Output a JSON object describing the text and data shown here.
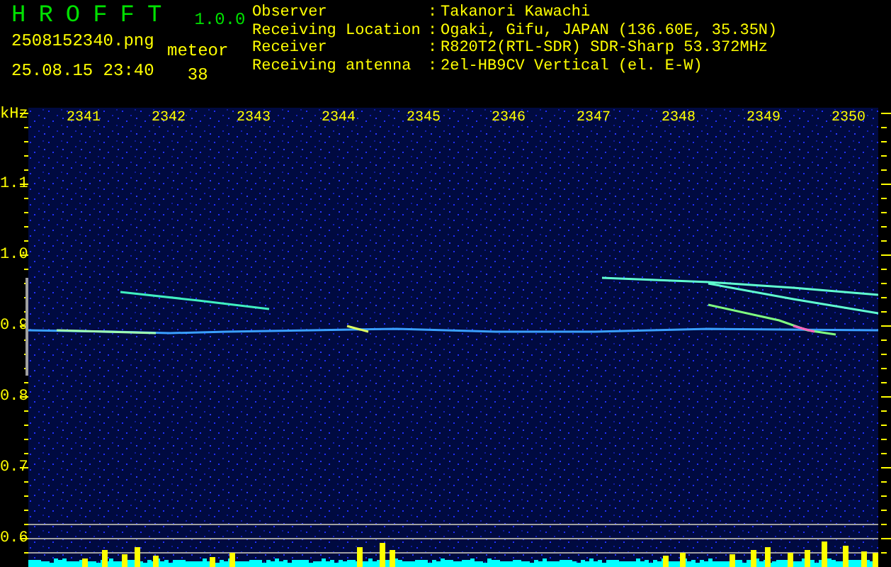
{
  "header": {
    "logo": "HROFFT",
    "version": "1.0.0",
    "filename": "2508152340.png",
    "datetime": "25.08.15 23:40",
    "count_label": "meteor",
    "count": "38"
  },
  "info": [
    {
      "label": "Observer",
      "separator": ":",
      "value": "Takanori Kawachi"
    },
    {
      "label": "Receiving Location",
      "separator": ":",
      "value": "Ogaki, Gifu, JAPAN (136.60E, 35.35N)"
    },
    {
      "label": "Receiver",
      "separator": ":",
      "value": "R820T2(RTL-SDR) SDR-Sharp 53.372MHz"
    },
    {
      "label": "Receiving antenna",
      "separator": ":",
      "value": "2el-HB9CV Vertical (el. E-W)"
    }
  ],
  "spectrogram": {
    "unit": "kHz",
    "time_labels": [
      "2341",
      "2342",
      "2343",
      "2344",
      "2345",
      "2346",
      "2347",
      "2348",
      "2349",
      "2350"
    ],
    "frequency_labels": [
      "1.1",
      "1.0",
      "0.9",
      "0.8",
      "0.7",
      "0.6"
    ]
  }
}
